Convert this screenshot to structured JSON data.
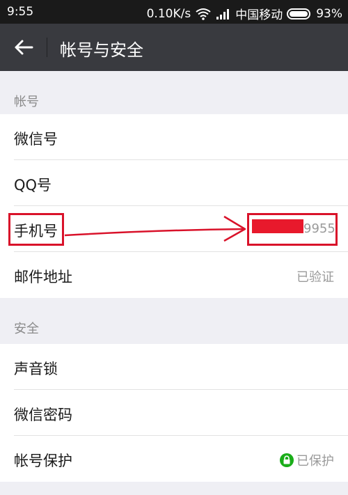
{
  "status_bar": {
    "time": "9:55",
    "net_speed": "0.10K/s",
    "carrier": "中国移动",
    "battery": "93%"
  },
  "header": {
    "title": "帐号与安全"
  },
  "sections": {
    "account": {
      "label": "帐号",
      "rows": [
        {
          "label": "微信号",
          "value": ""
        },
        {
          "label": "QQ号",
          "value": ""
        },
        {
          "label": "手机号",
          "value": "9955"
        },
        {
          "label": "邮件地址",
          "value": "已验证"
        }
      ]
    },
    "security": {
      "label": "安全",
      "rows": [
        {
          "label": "声音锁",
          "value": ""
        },
        {
          "label": "微信密码",
          "value": ""
        },
        {
          "label": "帐号保护",
          "value": "已保护"
        }
      ]
    }
  },
  "colors": {
    "title_bar": "#393a3f",
    "status_bar": "#1a1a1a",
    "annotation": "#d9122a",
    "protect_green": "#1aad19"
  },
  "icons": [
    "back-arrow-icon",
    "wifi-icon",
    "signal-icon",
    "battery-icon",
    "lock-icon"
  ]
}
